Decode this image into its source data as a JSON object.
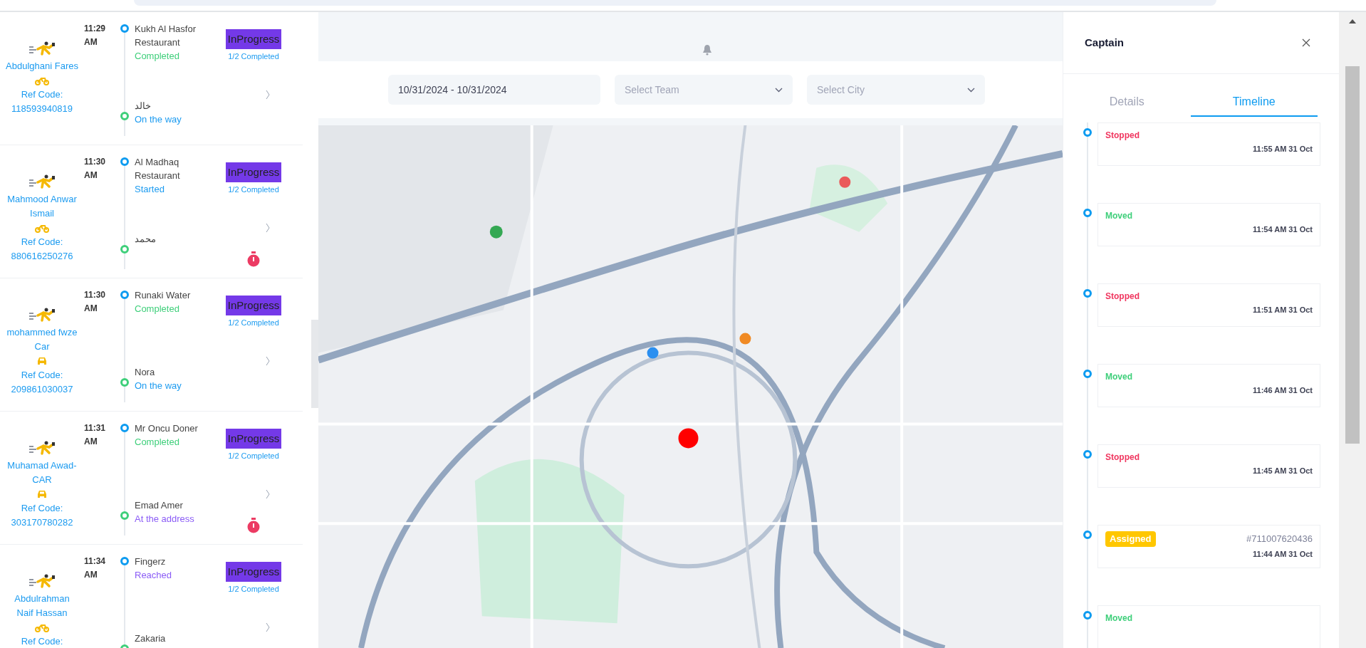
{
  "orders": [
    {
      "captain": "Abdulghani Fares",
      "vehicle": {
        "kind": "bike"
      },
      "ref_label": "Ref Code:",
      "ref_code": "118593940819",
      "time": "11:29",
      "meridiem": "AM",
      "pickup": {
        "name": "Kukh Al Hasfor Restaurant",
        "status": "Completed",
        "kind": "completed"
      },
      "dropoff": {
        "name": "خالد",
        "status": "On the way",
        "kind": "on_the_way"
      },
      "badge": "InProgress",
      "progress": "1/2 Completed",
      "timer": false
    },
    {
      "captain": "Mahmood Anwar Ismail",
      "vehicle": {
        "kind": "bike"
      },
      "ref_label": "Ref Code:",
      "ref_code": "880616250276",
      "time": "11:30",
      "meridiem": "AM",
      "pickup": {
        "name": "Al Madhaq Restaurant",
        "status": "Started",
        "kind": "started"
      },
      "dropoff": {
        "name": "محمد"
      },
      "badge": "InProgress",
      "progress": "1/2 Completed",
      "timer": true
    },
    {
      "captain": "mohammed fwze Car",
      "vehicle": {
        "kind": "car"
      },
      "ref_label": "Ref Code:",
      "ref_code": "209861030037",
      "time": "11:30",
      "meridiem": "AM",
      "pickup": {
        "name": "Runaki Water",
        "status": "Completed",
        "kind": "completed"
      },
      "dropoff": {
        "name": "Nora",
        "status": "On the way",
        "kind": "on_the_way"
      },
      "badge": "InProgress",
      "progress": "1/2 Completed",
      "timer": false
    },
    {
      "captain": "Muhamad Awad-CAR",
      "vehicle": {
        "kind": "car"
      },
      "ref_label": "Ref Code:",
      "ref_code": "303170780282",
      "time": "11:31",
      "meridiem": "AM",
      "pickup": {
        "name": "Mr Oncu Doner",
        "status": "Completed",
        "kind": "completed"
      },
      "dropoff": {
        "name": "Emad Amer",
        "status": "At the address",
        "kind": "at_address"
      },
      "badge": "InProgress",
      "progress": "1/2 Completed",
      "timer": true
    },
    {
      "captain": "Abdulrahman Naif Hassan",
      "vehicle": {
        "kind": "bike"
      },
      "ref_label": "Ref Code:",
      "time": "11:34",
      "meridiem": "AM",
      "pickup": {
        "name": "Fingerz",
        "status": "Reached",
        "kind": "reached"
      },
      "dropoff": {
        "name": "Zakaria"
      },
      "badge": "InProgress",
      "progress": "1/2 Completed",
      "timer": false
    }
  ],
  "filters": {
    "date_range": "10/31/2024 - 10/31/2024",
    "team": {
      "placeholder": "Select Team"
    },
    "city": {
      "placeholder": "Select City"
    }
  },
  "panel": {
    "title": "Captain",
    "tabs": [
      {
        "label": "Details",
        "selected": false
      },
      {
        "label": "Timeline",
        "selected": true
      }
    ],
    "timeline": [
      {
        "kind": "stopped",
        "label": "Stopped",
        "time": "11:55 AM 31 Oct"
      },
      {
        "kind": "moved",
        "label": "Moved",
        "time": "11:54 AM 31 Oct"
      },
      {
        "kind": "stopped",
        "label": "Stopped",
        "time": "11:51 AM 31 Oct"
      },
      {
        "kind": "moved",
        "label": "Moved",
        "time": "11:46 AM 31 Oct"
      },
      {
        "kind": "stopped",
        "label": "Stopped",
        "time": "11:45 AM 31 Oct"
      },
      {
        "kind": "assigned",
        "label": "Assigned",
        "order": "#711007620436",
        "time": "11:44 AM 31 Oct"
      },
      {
        "kind": "moved",
        "label": "Moved"
      }
    ]
  }
}
